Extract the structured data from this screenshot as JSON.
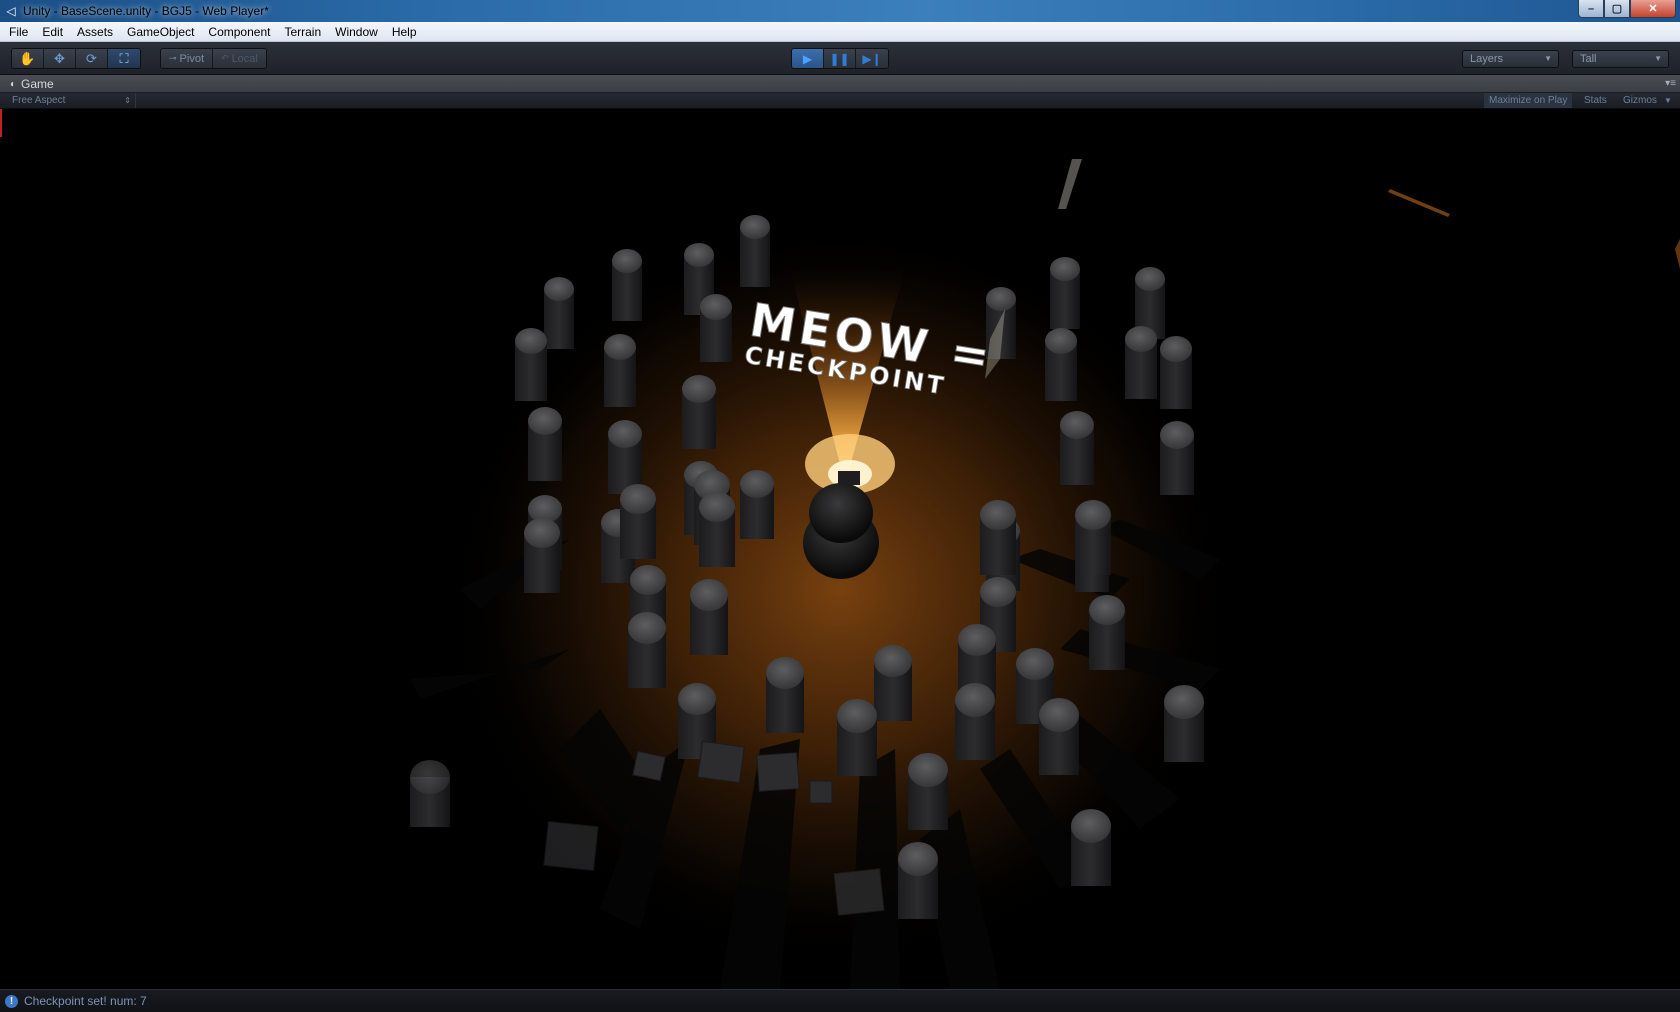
{
  "window": {
    "title": "Unity - BaseScene.unity - BGJ5 - Web Player*",
    "controls": {
      "minimize": "–",
      "maximize": "▢",
      "close": "✕"
    }
  },
  "menu": {
    "items": [
      "File",
      "Edit",
      "Assets",
      "GameObject",
      "Component",
      "Terrain",
      "Window",
      "Help"
    ]
  },
  "toolbar": {
    "transform_tools": [
      {
        "name": "hand-tool",
        "icon": "hand-icon",
        "glyph": "✋",
        "active": false
      },
      {
        "name": "move-tool",
        "icon": "move-icon",
        "glyph": "✥",
        "active": false
      },
      {
        "name": "rotate-tool",
        "icon": "rotate-icon",
        "glyph": "⟳",
        "active": false
      },
      {
        "name": "scale-tool",
        "icon": "scale-icon",
        "glyph": "⛶",
        "active": true
      }
    ],
    "pivot_label": "Pivot",
    "local_label": "Local",
    "play_state": "playing",
    "layers_label": "Layers",
    "layout_label": "Tall"
  },
  "game_view": {
    "tab_label": "Game",
    "aspect_label": "Free Aspect",
    "maximize_label": "Maximize on Play",
    "stats_label": "Stats",
    "gizmos_label": "Gizmos"
  },
  "scene": {
    "overlay_text_line1": "MEOW =",
    "overlay_text_line2": "CHECKPOINT",
    "light_color": "#ff9a2a",
    "floor_glow_color": "#7a3e0a"
  },
  "status": {
    "message": "Checkpoint set! num: 7"
  },
  "colors": {
    "accent_blue": "#3d78c8",
    "play_active": "#49a4ff"
  }
}
